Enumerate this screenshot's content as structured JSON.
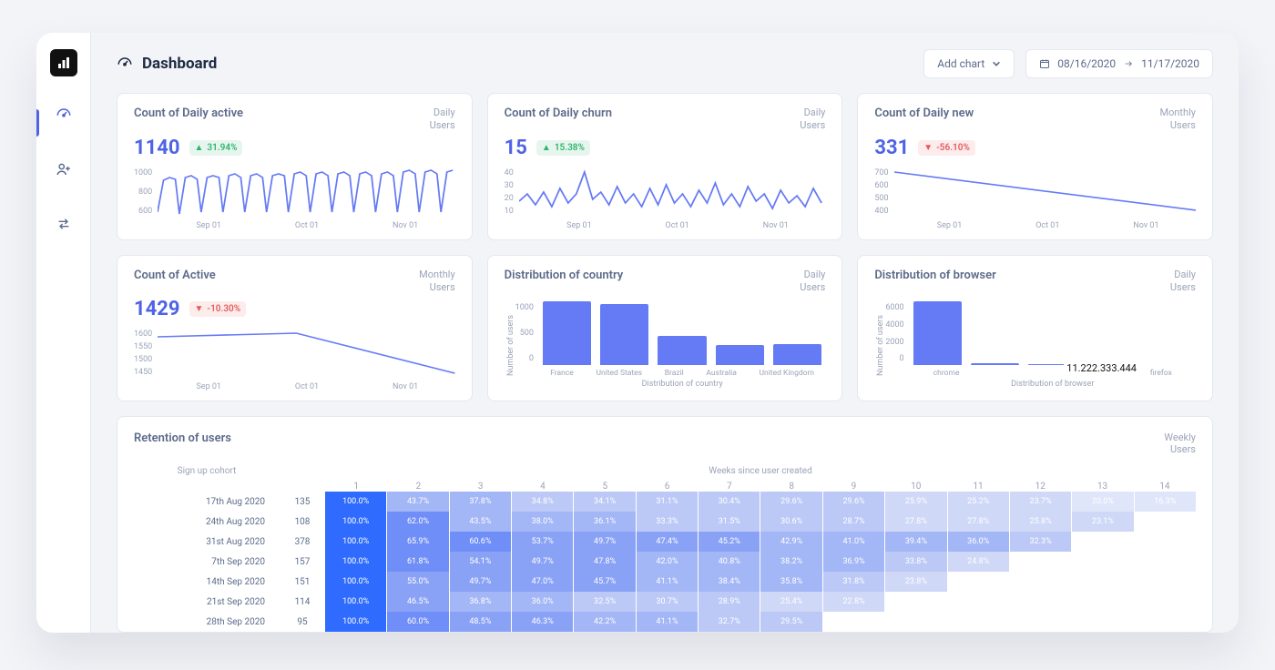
{
  "sidebar": {
    "items": [
      "analytics",
      "dashboard",
      "users",
      "transfers"
    ],
    "active_index": 1
  },
  "header": {
    "title": "Dashboard",
    "add_chart_label": "Add chart",
    "date_from": "08/16/2020",
    "date_to": "11/17/2020"
  },
  "cards": [
    {
      "title": "Count of Daily active",
      "value": "1140",
      "delta": "31.94%",
      "dir": "up",
      "period_top": "Daily",
      "period_bottom": "Users",
      "y": [
        "1000",
        "800",
        "600"
      ],
      "x": [
        "Sep 01",
        "Oct 01",
        "Nov 01"
      ],
      "series": "wave"
    },
    {
      "title": "Count of Daily churn",
      "value": "15",
      "delta": "15.38%",
      "dir": "up",
      "period_top": "Daily",
      "period_bottom": "Users",
      "y": [
        "40",
        "30",
        "20",
        "10"
      ],
      "x": [
        "Sep 01",
        "Oct 01",
        "Nov 01"
      ],
      "series": "noise"
    },
    {
      "title": "Count of Daily new",
      "value": "331",
      "delta": "-56.10%",
      "dir": "down",
      "period_top": "Monthly",
      "period_bottom": "Users",
      "y": [
        "700",
        "600",
        "500",
        "400"
      ],
      "x": [
        "Sep 01",
        "Oct 01",
        "Nov 01"
      ],
      "series": "decline"
    },
    {
      "title": "Count of Active",
      "value": "1429",
      "delta": "-10.30%",
      "dir": "down",
      "period_top": "Monthly",
      "period_bottom": "Users",
      "y": [
        "1600",
        "1550",
        "1500",
        "1450"
      ],
      "x": [
        "Sep 01",
        "Oct 01",
        "Nov 01"
      ],
      "series": "kink"
    },
    {
      "title": "Distribution of country",
      "period_top": "Daily",
      "period_bottom": "Users",
      "y": [
        "1000",
        "500",
        "0"
      ],
      "xlabel": "Distribution of country",
      "ylabel": "Number of users",
      "bars": [
        {
          "label": "France",
          "v": 1150
        },
        {
          "label": "United States",
          "v": 1100
        },
        {
          "label": "Brazil",
          "v": 530
        },
        {
          "label": "Australia",
          "v": 360
        },
        {
          "label": "United Kingdom",
          "v": 380
        }
      ]
    },
    {
      "title": "Distribution of browser",
      "period_top": "Daily",
      "period_bottom": "Users",
      "y": [
        "6000",
        "4000",
        "2000",
        "0"
      ],
      "xlabel": "Distribution of browser",
      "ylabel": "Number of users",
      "bars": [
        {
          "label": "chrome",
          "v": 6500
        },
        {
          "label": "",
          "v": 200
        },
        {
          "label": "",
          "v": 80
        },
        {
          "label": "",
          "v": 50
        },
        {
          "label": "firefox",
          "v": 30
        }
      ],
      "overlay_ip": "11.222.333.444"
    }
  ],
  "retention": {
    "title": "Retention of users",
    "period_top": "Weekly",
    "period_bottom": "Users",
    "left_header": "Sign up cohort",
    "right_header": "Weeks since user created",
    "week_cols": [
      "1",
      "2",
      "3",
      "4",
      "5",
      "6",
      "7",
      "8",
      "9",
      "10",
      "11",
      "12",
      "13",
      "14"
    ],
    "rows": [
      {
        "date": "17th Aug 2020",
        "n": "135",
        "cells": [
          "100.0%",
          "43.7%",
          "37.8%",
          "34.8%",
          "34.1%",
          "31.1%",
          "30.4%",
          "29.6%",
          "29.6%",
          "25.9%",
          "25.2%",
          "23.7%",
          "20.0%",
          "16.3%"
        ]
      },
      {
        "date": "24th Aug 2020",
        "n": "108",
        "cells": [
          "100.0%",
          "62.0%",
          "43.5%",
          "38.0%",
          "36.1%",
          "33.3%",
          "31.5%",
          "30.6%",
          "28.7%",
          "27.8%",
          "27.8%",
          "25.8%",
          "23.1%"
        ]
      },
      {
        "date": "31st Aug 2020",
        "n": "378",
        "cells": [
          "100.0%",
          "65.9%",
          "60.6%",
          "53.7%",
          "49.7%",
          "47.4%",
          "45.2%",
          "42.9%",
          "41.0%",
          "39.4%",
          "36.0%",
          "32.3%"
        ]
      },
      {
        "date": "7th Sep 2020",
        "n": "157",
        "cells": [
          "100.0%",
          "61.8%",
          "54.1%",
          "49.7%",
          "47.8%",
          "42.0%",
          "40.8%",
          "38.2%",
          "36.9%",
          "33.8%",
          "24.8%"
        ]
      },
      {
        "date": "14th Sep 2020",
        "n": "151",
        "cells": [
          "100.0%",
          "55.0%",
          "49.7%",
          "47.0%",
          "45.7%",
          "41.1%",
          "38.4%",
          "35.8%",
          "31.8%",
          "23.8%"
        ]
      },
      {
        "date": "21st Sep 2020",
        "n": "114",
        "cells": [
          "100.0%",
          "46.5%",
          "36.8%",
          "36.0%",
          "32.5%",
          "30.7%",
          "28.9%",
          "25.4%",
          "22.8%"
        ]
      },
      {
        "date": "28th Sep 2020",
        "n": "95",
        "cells": [
          "100.0%",
          "60.0%",
          "48.5%",
          "46.3%",
          "42.2%",
          "41.1%",
          "32.7%",
          "29.5%"
        ]
      }
    ]
  },
  "chart_data": [
    {
      "type": "line",
      "title": "Count of Daily active",
      "ylabel": "",
      "ylim": [
        600,
        1100
      ],
      "x_ticks": [
        "Sep 01",
        "Oct 01",
        "Nov 01"
      ],
      "note": "daily oscillation between ~600 weekend and ~1000-1100 weekday across Aug-Nov 2020"
    },
    {
      "type": "line",
      "title": "Count of Daily churn",
      "ylim": [
        0,
        45
      ],
      "x_ticks": [
        "Sep 01",
        "Oct 01",
        "Nov 01"
      ],
      "note": "noisy daily series mostly 10-30 with spike ~45 mid-Sep"
    },
    {
      "type": "line",
      "title": "Count of Daily new",
      "ylim": [
        350,
        750
      ],
      "x_ticks": [
        "Sep 01",
        "Oct 01",
        "Nov 01"
      ],
      "series": [
        {
          "name": "new",
          "x": [
            "Sep 01",
            "Oct 01",
            "Nov 01"
          ],
          "values": [
            720,
            560,
            390
          ]
        }
      ]
    },
    {
      "type": "line",
      "title": "Count of Active",
      "ylim": [
        1440,
        1610
      ],
      "x_ticks": [
        "Sep 01",
        "Oct 01",
        "Nov 01"
      ],
      "series": [
        {
          "name": "active",
          "x": [
            "Sep 01",
            "Oct 01",
            "Nov 01"
          ],
          "values": [
            1590,
            1600,
            1450
          ]
        }
      ]
    },
    {
      "type": "bar",
      "title": "Distribution of country",
      "xlabel": "Distribution of country",
      "ylabel": "Number of users",
      "ylim": [
        0,
        1200
      ],
      "categories": [
        "France",
        "United States",
        "Brazil",
        "Australia",
        "United Kingdom"
      ],
      "values": [
        1150,
        1100,
        530,
        360,
        380
      ]
    },
    {
      "type": "bar",
      "title": "Distribution of browser",
      "xlabel": "Distribution of browser",
      "ylabel": "Number of users",
      "ylim": [
        0,
        7000
      ],
      "categories": [
        "chrome",
        "",
        "",
        "",
        "firefox"
      ],
      "values": [
        6500,
        200,
        80,
        50,
        30
      ]
    }
  ]
}
